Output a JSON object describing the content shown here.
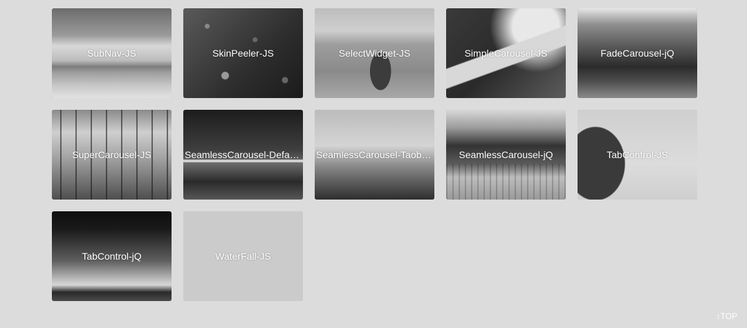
{
  "cards": [
    {
      "title": "SubNav-JS",
      "thumb": "t-subnav"
    },
    {
      "title": "SkinPeeler-JS",
      "thumb": "t-skin"
    },
    {
      "title": "SelectWidget-JS",
      "thumb": "t-select"
    },
    {
      "title": "SimpleCarousel-JS",
      "thumb": "t-simple"
    },
    {
      "title": "FadeCarousel-jQ",
      "thumb": "t-fade"
    },
    {
      "title": "SuperCarousel-JS",
      "thumb": "t-super"
    },
    {
      "title": "SeamlessCarousel-Default-JS",
      "thumb": "t-seam-default"
    },
    {
      "title": "SeamlessCarousel-Taobao-JS",
      "thumb": "t-seam-taobao"
    },
    {
      "title": "SeamlessCarousel-jQ",
      "thumb": "t-seam-jq"
    },
    {
      "title": "TabControl-JS",
      "thumb": "t-tabjs"
    },
    {
      "title": "TabControl-jQ",
      "thumb": "t-tabjq"
    },
    {
      "title": "WaterFall-JS",
      "thumb": "t-water"
    }
  ],
  "top_link": "↑TOP",
  "colors": {
    "background": "#dcdcdc",
    "text": "#ffffff"
  }
}
